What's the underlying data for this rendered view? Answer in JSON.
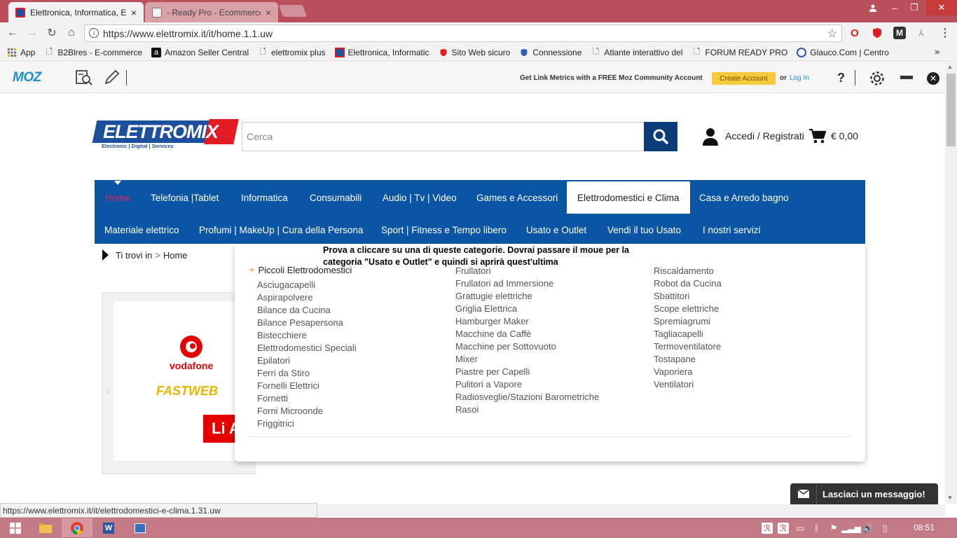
{
  "browser": {
    "tabs": [
      {
        "title": "Elettronica, Informatica, E",
        "close": "×"
      },
      {
        "title": "- Ready Pro - Ecommerce",
        "close": "×"
      }
    ],
    "url": "https://www.elettromix.it/it/home.1.1.uw",
    "window_controls": {
      "minimize": "–",
      "maximize": "❐",
      "close": "✕"
    }
  },
  "bookmarks": [
    {
      "label": "App",
      "icon": "apps-grid-icon"
    },
    {
      "label": "B2Blres - E-commerce",
      "icon": "page-icon"
    },
    {
      "label": "Amazon Seller Central",
      "icon": "amazon-icon"
    },
    {
      "label": "elettromix plus",
      "icon": "page-icon"
    },
    {
      "label": "Elettronica, Informatic",
      "icon": "elettromix-icon"
    },
    {
      "label": "Sito Web sicuro",
      "icon": "shield-icon"
    },
    {
      "label": "Connessione",
      "icon": "shield-icon"
    },
    {
      "label": "Atlante interattivo del",
      "icon": "page-icon"
    },
    {
      "label": "FORUM READY PRO",
      "icon": "page-icon"
    },
    {
      "label": "Glauco.Com | Centro",
      "icon": "glauco-icon"
    }
  ],
  "bookmarks_more": "»",
  "moz": {
    "logo": "MOZ",
    "message": "Get Link Metrics with a FREE Moz Community Account",
    "create": "Create Account",
    "or": "or",
    "login": "Log In",
    "help": "?"
  },
  "site": {
    "logo_text": "ELETTROMIX",
    "logo_tagline": "Electronic | Digital | Services",
    "search_placeholder": "Cerca",
    "login": "Accedi / Registrati",
    "cart_total": "€ 0,00",
    "nav_row1": [
      "Home",
      "Telefonia |Tablet",
      "Informatica",
      "Consumabili",
      "Audio | Tv | Video",
      "Games e Accessori",
      "Elettrodomestici e Clima",
      "Casa e Arredo bagno"
    ],
    "nav_row2": [
      "Materiale elettrico",
      "Profumi | MakeUp | Cura della Persona",
      "Sport | Fitness e Tempo libero",
      "Usato e Outlet",
      "Vendi il tuo Usato",
      "I nostri servizi"
    ],
    "breadcrumb_prefix": "Ti trovi in",
    "breadcrumb_sep": ">",
    "breadcrumb_home": "Home",
    "banner": {
      "vodafone": "vodafone",
      "fastweb": "FASTWEB",
      "cta": "Li A"
    }
  },
  "mega": {
    "heading": "Piccoli Elettrodomestici",
    "col1": [
      "Asciugacapelli",
      "Aspirapolvere",
      "Bilance da Cucina",
      "Bilance Pesapersona",
      "Bistecchiere",
      "Elettrodomestici Speciali",
      "Epilatori",
      "Ferri da Stiro",
      "Fornelli Elettrici",
      "Fornetti",
      "Forni Microonde",
      "Friggitrici"
    ],
    "col2": [
      "Frullatori",
      "Frullatori ad Immersione",
      "Grattugie elettriche",
      "Griglia Elettrica",
      "Hamburger Maker",
      "Macchine da Caffè",
      "Macchine per Sottovuoto",
      "Mixer",
      "Piastre per Capelli",
      "Pulitori a Vapore",
      "Radiosveglie/Stazioni Barometriche",
      "Rasoi"
    ],
    "col3": [
      "Riscaldamento",
      "Robot da Cucina",
      "Sbattitori",
      "Scope elettriche",
      "Spremiagrumi",
      "Tagliacapelli",
      "Termoventilatore",
      "Tostapane",
      "Vaporiera",
      "Ventilatori"
    ]
  },
  "annotation": "Prova a cliccare su una di queste categorie. Dovrai passare il moue per la categoria \"Usato e Outlet\" e quindi si aprirà quest'ultima",
  "chat": "Lasciaci un messaggio!",
  "status_url": "https://www.elettromix.it/it/elettrodomestici-e-clima.1.31.uw",
  "clock": "08:51"
}
